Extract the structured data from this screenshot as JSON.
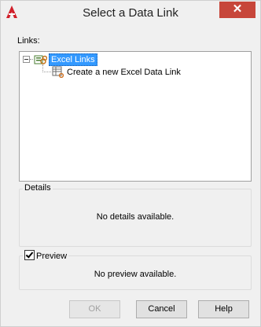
{
  "window": {
    "title": "Select a Data Link",
    "close_symbol": "✕"
  },
  "links": {
    "label": "Links:",
    "tree": {
      "root": {
        "label": "Excel Links",
        "expanded": true,
        "selected": true
      },
      "children": [
        {
          "label": "Create a new Excel Data Link"
        }
      ]
    }
  },
  "details": {
    "title": "Details",
    "message": "No details available."
  },
  "preview": {
    "title": "Preview",
    "checked": true,
    "message": "No preview available."
  },
  "buttons": {
    "ok": "OK",
    "cancel": "Cancel",
    "help": "Help"
  },
  "colors": {
    "selection": "#3399ff",
    "close_button": "#c7463a",
    "dialog_bg": "#f0f0f0"
  },
  "icons": {
    "app": "autocad-logo-icon",
    "root": "excel-links-folder-icon",
    "child": "new-excel-data-link-icon"
  }
}
